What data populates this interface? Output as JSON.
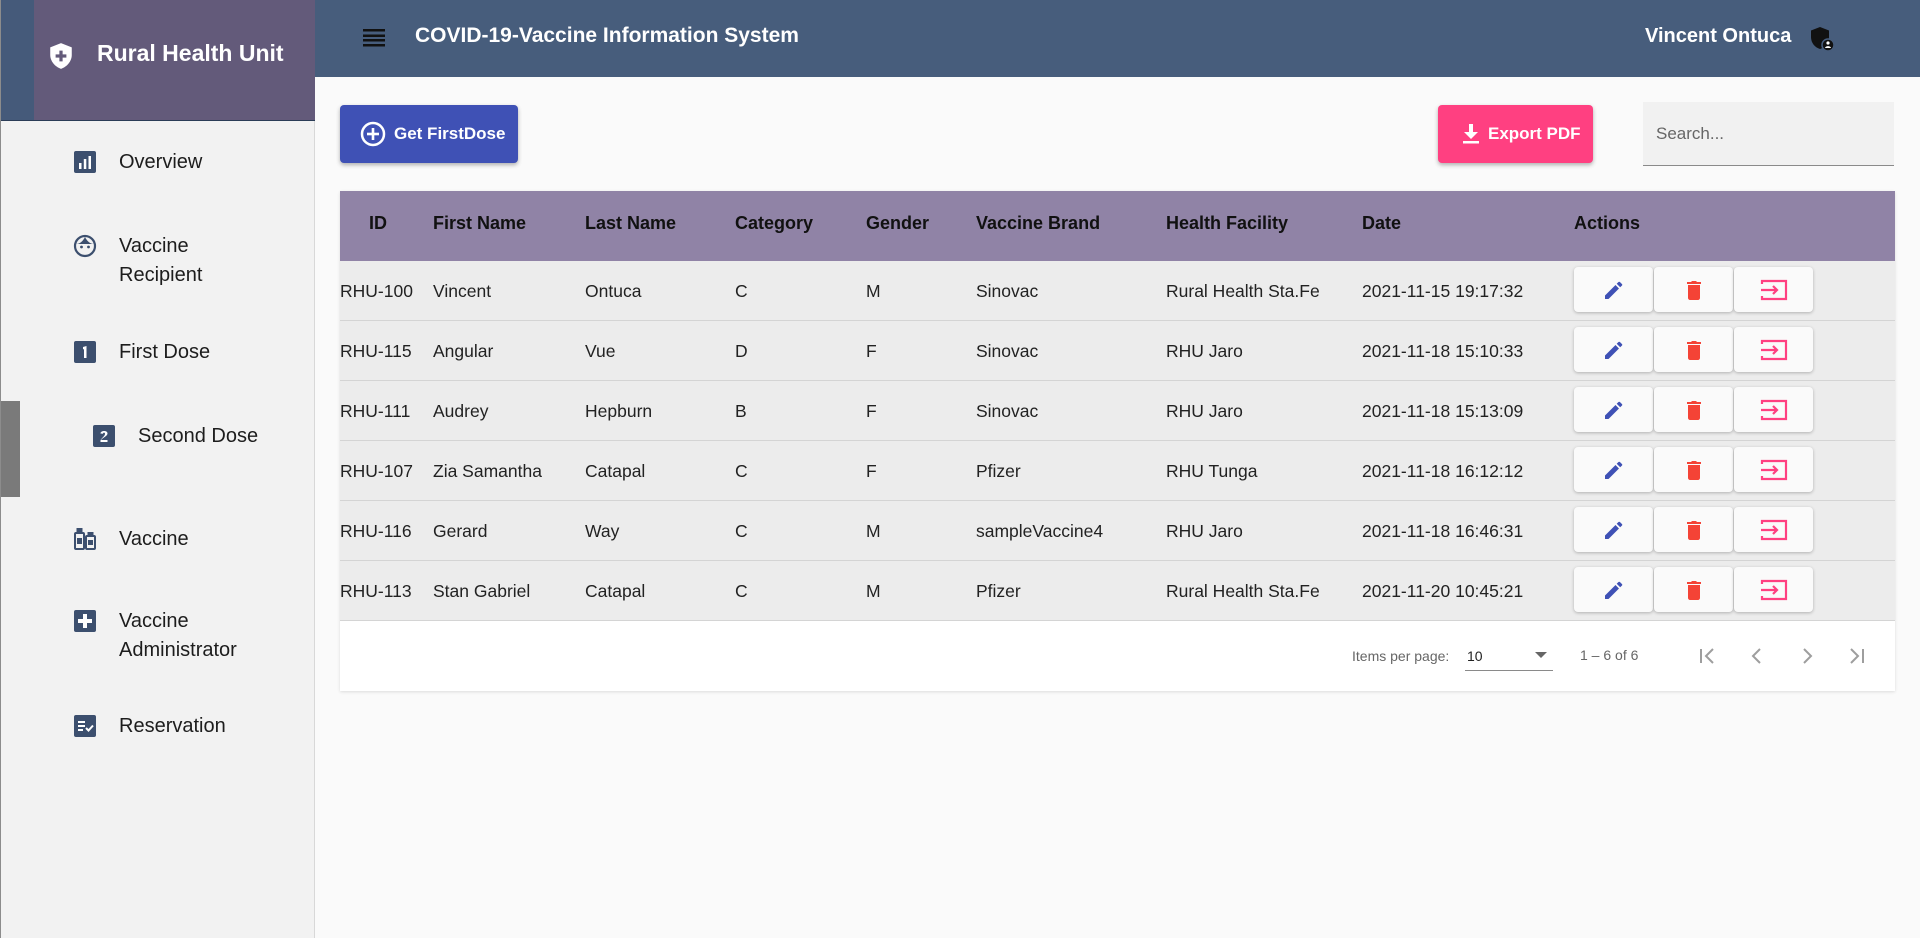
{
  "sidebar": {
    "title": "Rural Health Unit",
    "items": [
      {
        "label": "Overview",
        "icon": "chart-icon"
      },
      {
        "label": "Vaccine Recipient",
        "icon": "face-icon"
      },
      {
        "label": "First Dose",
        "icon": "number-one-icon"
      },
      {
        "label": "Second Dose",
        "icon": "number-two-icon"
      },
      {
        "label": "Vaccine",
        "icon": "vaccine-icon"
      },
      {
        "label": "Vaccine Administrator",
        "icon": "medical-plus-icon"
      },
      {
        "label": "Reservation",
        "icon": "checklist-icon"
      }
    ]
  },
  "header": {
    "title": "COVID-19-Vaccine Information System",
    "user": "Vincent Ontuca"
  },
  "toolbar": {
    "get_first_dose": "Get FirstDose",
    "export_pdf": "Export PDF",
    "search_placeholder": "Search..."
  },
  "table": {
    "columns": [
      "ID",
      "First Name",
      "Last Name",
      "Category",
      "Gender",
      "Vaccine Brand",
      "Health Facility",
      "Date",
      "Actions"
    ],
    "rows": [
      [
        "RHU-100",
        "Vincent",
        "Ontuca",
        "C",
        "M",
        "Sinovac",
        "Rural Health Sta.Fe",
        "2021-11-15 19:17:32"
      ],
      [
        "RHU-115",
        "Angular",
        "Vue",
        "D",
        "F",
        "Sinovac",
        "RHU Jaro",
        "2021-11-18 15:10:33"
      ],
      [
        "RHU-111",
        "Audrey",
        "Hepburn",
        "B",
        "F",
        "Sinovac",
        "RHU Jaro",
        "2021-11-18 15:13:09"
      ],
      [
        "RHU-107",
        "Zia Samantha",
        "Catapal",
        "C",
        "F",
        "Pfizer",
        "RHU Tunga",
        "2021-11-18 16:12:12"
      ],
      [
        "RHU-116",
        "Gerard",
        "Way",
        "C",
        "M",
        "sampleVaccine4",
        "RHU Jaro",
        "2021-11-18 16:46:31"
      ],
      [
        "RHU-113",
        "Stan Gabriel",
        "Catapal",
        "C",
        "M",
        "Pfizer",
        "Rural Health Sta.Fe",
        "2021-11-20 10:45:21"
      ]
    ]
  },
  "pagination": {
    "items_per_page_label": "Items per page:",
    "items_per_page": "10",
    "range": "1 – 6 of 6"
  },
  "colors": {
    "header": "#475d7c",
    "sidebar_brand": "#635a7a",
    "table_header": "#9083a6",
    "primary": "#3f51b5",
    "accent": "#ff4081",
    "warn": "#f44336"
  }
}
